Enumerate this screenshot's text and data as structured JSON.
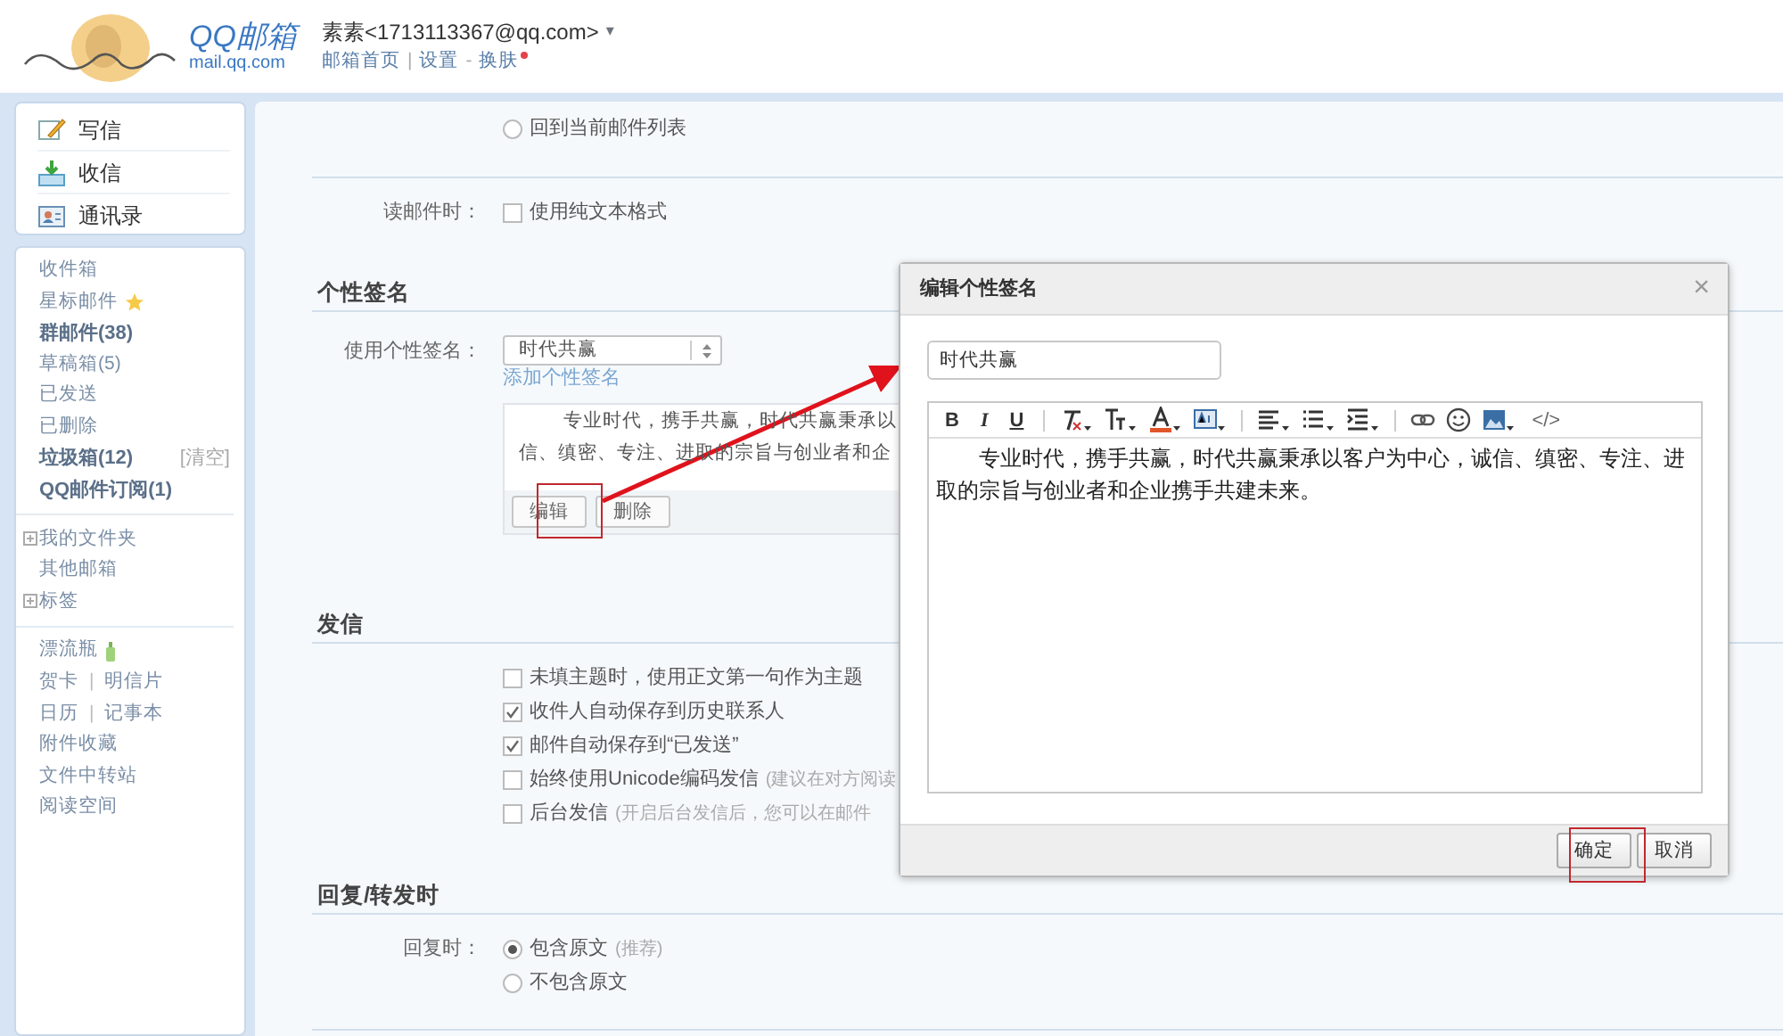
{
  "header": {
    "logo_title": "QQ邮箱",
    "logo_domain": "mail.qq.com",
    "account": "素素<1713113367@qq.com>",
    "account_caret": "▾",
    "nav": [
      {
        "kind": "link",
        "text": "邮箱首页"
      },
      {
        "kind": "sep",
        "text": "|"
      },
      {
        "kind": "link",
        "text": "设置"
      },
      {
        "kind": "sep",
        "text": "-"
      },
      {
        "kind": "link",
        "text": "换肤",
        "notify": true
      }
    ]
  },
  "sidebar": {
    "actions": [
      {
        "kind": "compose",
        "text": "写信"
      },
      {
        "kind": "inbox",
        "text": "收信"
      },
      {
        "kind": "contacts",
        "text": "通讯录"
      }
    ],
    "groups": [
      [
        {
          "kind": "plain",
          "text": "收件箱",
          "bold": false
        },
        {
          "kind": "starred",
          "text": "星标邮件",
          "bold": false
        },
        {
          "kind": "plain",
          "text": "群邮件(38)",
          "bold": true
        },
        {
          "kind": "plain",
          "text": "草稿箱(5)",
          "bold": false
        },
        {
          "kind": "plain",
          "text": "已发送",
          "bold": false
        },
        {
          "kind": "plain",
          "text": "已删除",
          "bold": false
        },
        {
          "kind": "plain",
          "text": "垃圾箱(12)",
          "bold": true,
          "action": "[清空]"
        },
        {
          "kind": "plain",
          "text": "QQ邮件订阅(1)",
          "bold": true
        }
      ],
      [
        {
          "kind": "expandable",
          "text": "我的文件夹",
          "bold": false
        },
        {
          "kind": "plain",
          "text": "其他邮箱",
          "bold": false
        },
        {
          "kind": "expandable",
          "text": "标签",
          "bold": false
        }
      ],
      [
        {
          "kind": "bottle",
          "text": "漂流瓶",
          "bold": false
        },
        {
          "kind": "pair",
          "parts": [
            "贺卡",
            "明信片"
          ],
          "separator": "|"
        },
        {
          "kind": "pair",
          "parts": [
            "日历",
            "记事本"
          ],
          "separator": "|"
        },
        {
          "kind": "plain",
          "text": "附件收藏",
          "bold": false
        },
        {
          "kind": "plain",
          "text": "文件中转站",
          "bold": false
        },
        {
          "kind": "plain",
          "text": "阅读空间",
          "bold": false
        }
      ]
    ]
  },
  "settings": [
    {
      "rows": [
        {
          "kind": "radio",
          "label": "",
          "options": [
            {
              "text": "回到当前邮件列表",
              "selected": false
            }
          ]
        }
      ]
    },
    {
      "rows": [
        {
          "kind": "checkbox",
          "label": "读邮件时：",
          "options": [
            {
              "text": "使用纯文本格式",
              "checked": false
            }
          ]
        }
      ]
    },
    {
      "heading": "个性签名",
      "rows": [
        {
          "kind": "signature",
          "label": "使用个性签名：",
          "select": "时代共赢",
          "add_link": "添加个性签名",
          "preview_lines": [
            "专业时代，携手共赢，时代共赢秉承以",
            "信、缜密、专注、进取的宗旨与创业者和企"
          ],
          "buttons": [
            "编辑",
            "删除"
          ]
        }
      ]
    },
    {
      "heading": "发信",
      "rows": [
        {
          "kind": "checkbox",
          "label": "",
          "options": [
            {
              "text": "未填主题时，使用正文第一句作为主题",
              "checked": false
            },
            {
              "text": "收件人自动保存到历史联系人",
              "checked": true
            },
            {
              "text": "邮件自动保存到“已发送”",
              "checked": true
            },
            {
              "text": "始终使用Unicode编码发信",
              "hint": "(建议在对方阅读",
              "checked": false
            },
            {
              "text": "后台发信",
              "hint": "(开启后台发信后，您可以在邮件",
              "checked": false
            }
          ]
        }
      ]
    },
    {
      "heading": "回复/转发时",
      "rows": [
        {
          "kind": "radio",
          "label": "回复时：",
          "options": [
            {
              "text": "包含原文",
              "hint": "(推荐)",
              "selected": true
            },
            {
              "text": "不包含原文",
              "selected": false
            }
          ]
        }
      ]
    }
  ],
  "dialog": {
    "title": "编辑个性签名",
    "close": "×",
    "name_value": "时代共赢",
    "toolbar": [
      {
        "kind": "bold",
        "text": "B"
      },
      {
        "kind": "italic",
        "text": "I"
      },
      {
        "kind": "underline",
        "text": "U"
      },
      {
        "kind": "sep"
      },
      {
        "kind": "clear-format"
      },
      {
        "kind": "font-size"
      },
      {
        "kind": "font-color"
      },
      {
        "kind": "highlight"
      },
      {
        "kind": "sep"
      },
      {
        "kind": "align"
      },
      {
        "kind": "list"
      },
      {
        "kind": "indent"
      },
      {
        "kind": "sep"
      },
      {
        "kind": "link"
      },
      {
        "kind": "emoji"
      },
      {
        "kind": "image"
      },
      {
        "kind": "code",
        "text": "</>"
      }
    ],
    "content": "专业时代，携手共赢，时代共赢秉承以客户为中心，诚信、缜密、专注、进取的宗旨与创业者和企业携手共建未来。",
    "buttons": [
      "确定",
      "取消"
    ]
  }
}
